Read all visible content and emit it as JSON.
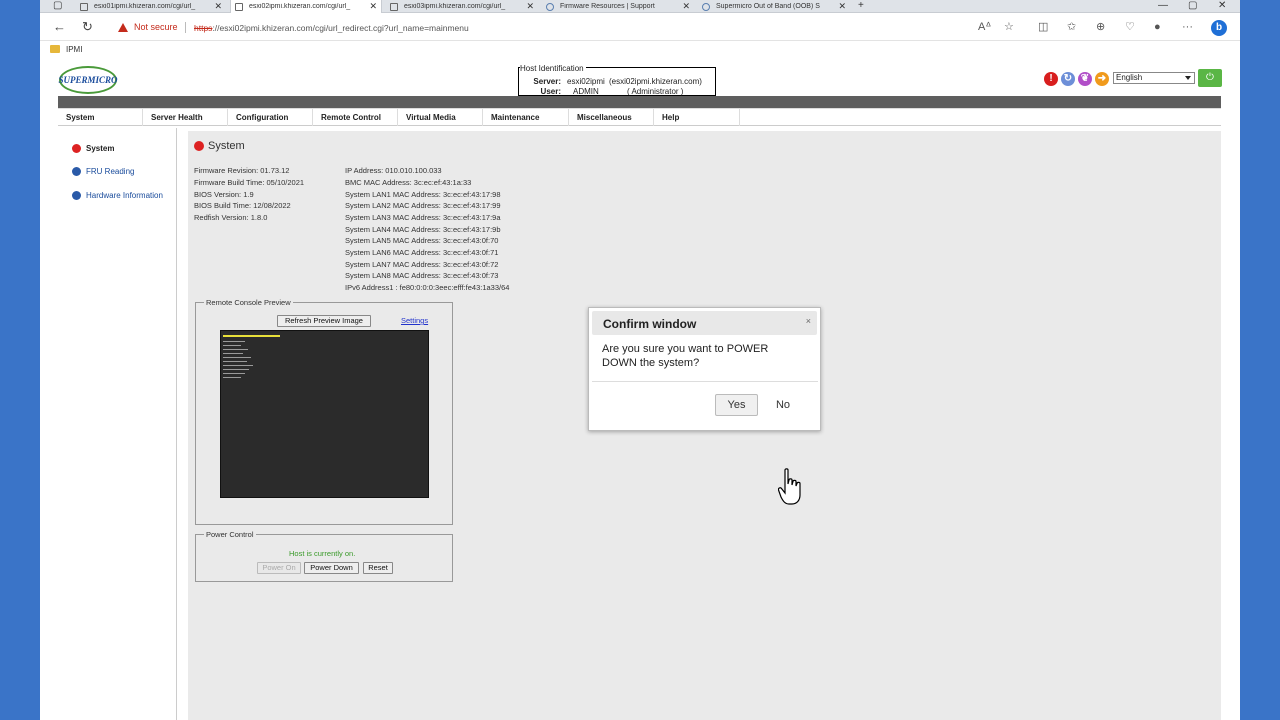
{
  "browser": {
    "tabs": [
      {
        "label": "esxi01ipmi.khizeran.com/cgi/url_",
        "active": false
      },
      {
        "label": "esxi02ipmi.khizeran.com/cgi/url_",
        "active": true
      },
      {
        "label": "esxi03ipmi.khizeran.com/cgi/url_",
        "active": false
      },
      {
        "label": "Firmware Resources | Support",
        "active": false
      },
      {
        "label": "Supermicro Out of Band (OOB) S",
        "active": false
      }
    ],
    "not_secure": "Not secure",
    "url_scheme": "https",
    "url_rest": "://esxi02ipmi.khizeran.com/cgi/url_redirect.cgi?url_name=mainmenu",
    "favorites": [
      "IPMI"
    ]
  },
  "header": {
    "logo_text": "SUPERMICRO",
    "host_identification": {
      "title": "Host Identification",
      "server_label": "Server:",
      "server_value": "esxi02ipmi",
      "server_fqdn": "(esxi02ipmi.khizeran.com)",
      "user_label": "User:",
      "user_value": "ADMIN",
      "user_role": "( Administrator )"
    },
    "language": "English"
  },
  "menu": [
    "System",
    "Server Health",
    "Configuration",
    "Remote Control",
    "Virtual Media",
    "Maintenance",
    "Miscellaneous",
    "Help"
  ],
  "sidebar": {
    "items": [
      {
        "label": "System",
        "active": true
      },
      {
        "label": "FRU Reading",
        "active": false
      },
      {
        "label": "Hardware Information",
        "active": false
      }
    ]
  },
  "system": {
    "title": "System",
    "left_info": [
      "Firmware Revision:  01.73.12",
      "Firmware Build Time:  05/10/2021",
      "BIOS Version:  1.9",
      "BIOS Build Time:  12/08/2022",
      "Redfish Version:  1.8.0"
    ],
    "right_info": [
      "IP Address:  010.010.100.033",
      "BMC MAC Address:  3c:ec:ef:43:1a:33",
      "System LAN1 MAC Address:  3c:ec:ef:43:17:98",
      "System LAN2 MAC Address:  3c:ec:ef:43:17:99",
      "System LAN3 MAC Address:  3c:ec:ef:43:17:9a",
      "System LAN4 MAC Address:  3c:ec:ef:43:17:9b",
      "System LAN5 MAC Address:  3c:ec:ef:43:0f:70",
      "System LAN6 MAC Address:  3c:ec:ef:43:0f:71",
      "System LAN7 MAC Address:  3c:ec:ef:43:0f:72",
      "System LAN8 MAC Address:  3c:ec:ef:43:0f:73",
      "IPv6 Address1 :  fe80:0:0:0:3eec:efff:fe43:1a33/64"
    ]
  },
  "console_preview": {
    "legend": "Remote Console Preview",
    "refresh_label": "Refresh Preview Image",
    "settings_label": "Settings"
  },
  "power_control": {
    "legend": "Power Control",
    "status": "Host is currently on.",
    "power_on_label": "Power On",
    "power_down_label": "Power Down",
    "reset_label": "Reset"
  },
  "modal": {
    "title": "Confirm window",
    "close": "×",
    "message": "Are you sure you want to POWER DOWN the system?",
    "yes_label": "Yes",
    "no_label": "No"
  }
}
